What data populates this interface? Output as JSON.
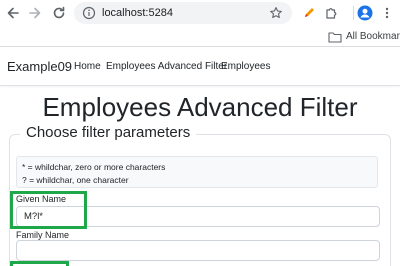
{
  "browser": {
    "url": "localhost:5284",
    "bookmarks_label": "All Bookmarks"
  },
  "navbar": {
    "brand": "Example09",
    "links": [
      {
        "label": "Home"
      },
      {
        "label": "Employees Advanced Filter"
      },
      {
        "label": "Employees"
      }
    ]
  },
  "page": {
    "title": "Employees Advanced Filter",
    "fieldset_legend": "Choose filter parameters",
    "hints": [
      "* = whildchar, zero or more characters",
      "? = whildchar, one character"
    ],
    "given_name": {
      "label": "Given Name",
      "value": "M?l*"
    },
    "family_name": {
      "label": "Family Name",
      "value": ""
    }
  },
  "colors": {
    "highlight": "#1fa84a",
    "profile": "#1a73e8"
  }
}
